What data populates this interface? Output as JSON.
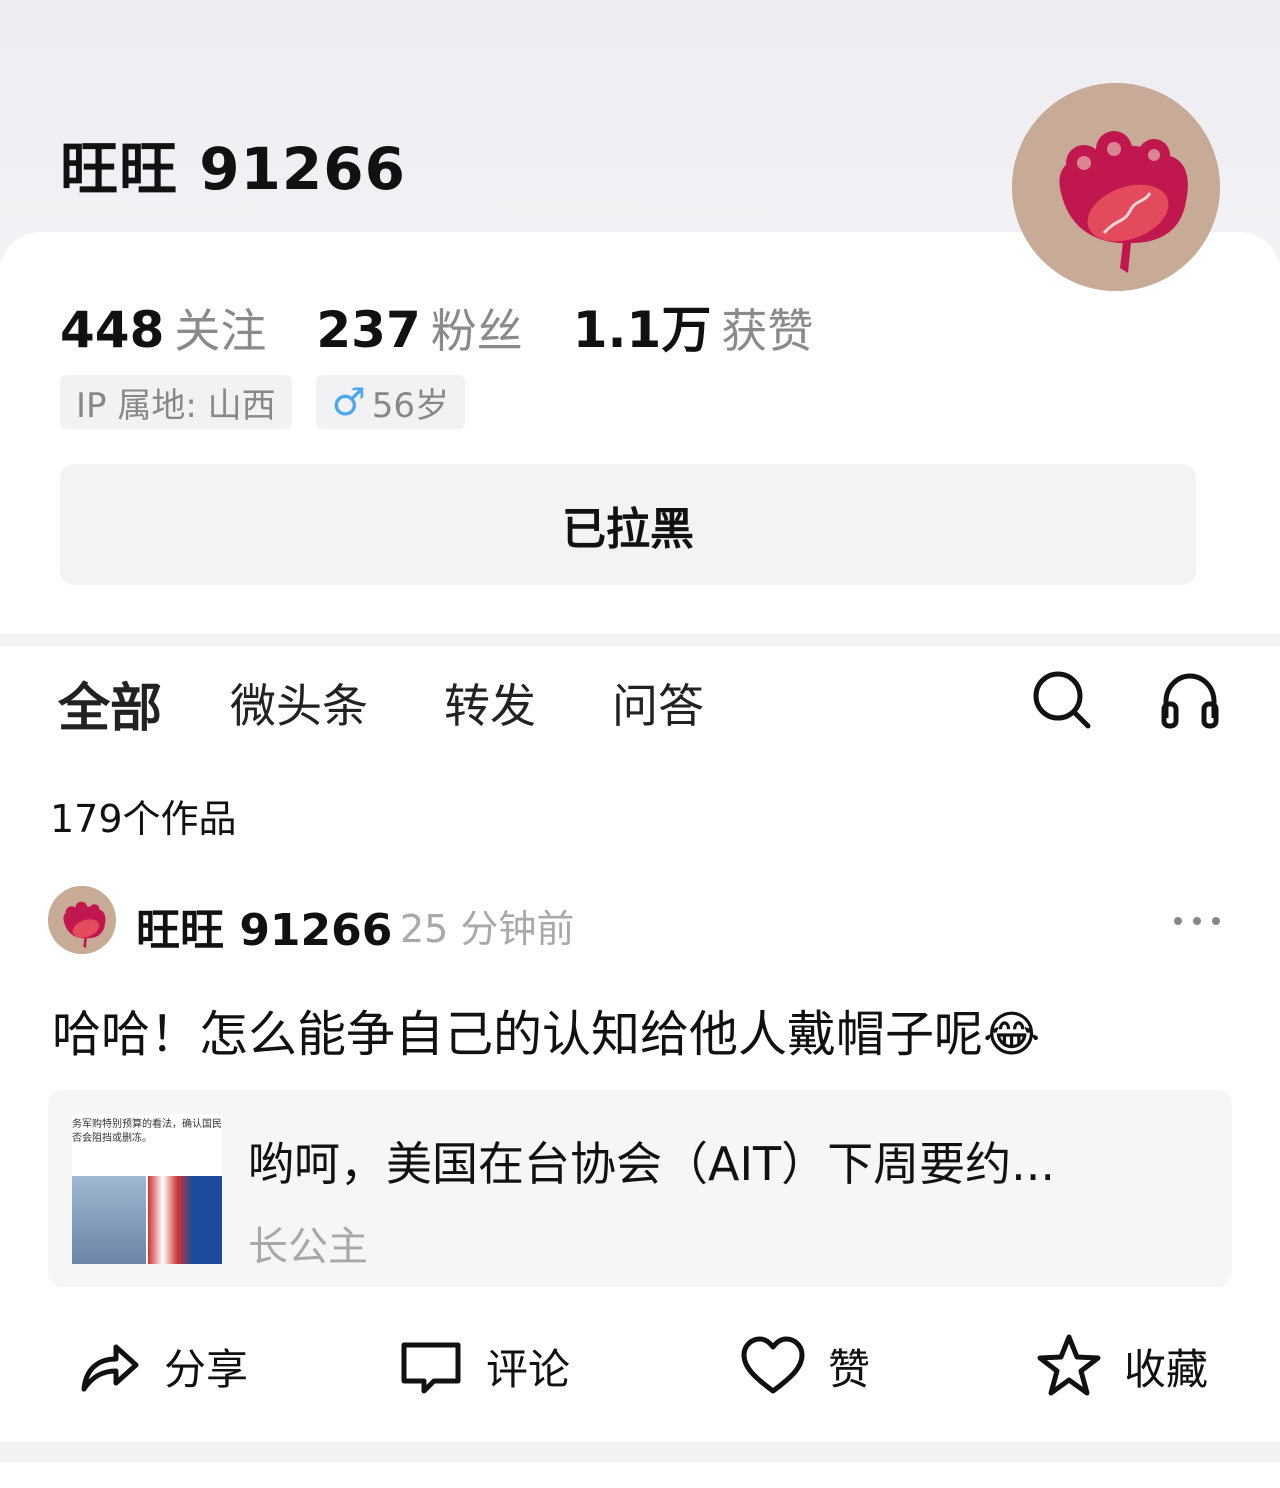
{
  "profile": {
    "username": "旺旺 91266",
    "stats": [
      {
        "num": "448",
        "label": "关注"
      },
      {
        "num": "237",
        "label": "粉丝"
      },
      {
        "num": "1.1万",
        "label": "获赞"
      }
    ],
    "ip_location": "IP 属地: 山西",
    "gender_symbol": "♂",
    "age": "56岁",
    "blocked_button": "已拉黑"
  },
  "tabs": [
    {
      "label": "全部",
      "active": true
    },
    {
      "label": "微头条",
      "active": false
    },
    {
      "label": "转发",
      "active": false
    },
    {
      "label": "问答",
      "active": false
    }
  ],
  "icons": {
    "search": "search-icon",
    "headphones": "headphones-icon",
    "more": "more-icon"
  },
  "works_count": "179个作品",
  "post": {
    "author": "旺旺 91266",
    "time": "25 分钟前",
    "text": "哈哈！怎么能争自己的认知给他人戴帽子呢😂",
    "quote": {
      "title": "哟呵，美国在台协会（AIT）下周要约...",
      "author": "长公主",
      "thumb_line1": "务军购特别预算的看法，确认国民党",
      "thumb_line2": "否会阻挡或删冻。"
    },
    "actions": [
      {
        "label": "分享",
        "icon": "share-icon"
      },
      {
        "label": "评论",
        "icon": "comment-icon"
      },
      {
        "label": "赞",
        "icon": "heart-icon"
      },
      {
        "label": "收藏",
        "icon": "star-icon"
      }
    ]
  },
  "colors": {
    "avatar_bg": "#c8ab96",
    "avatar_flower": "#c1174f",
    "male_icon": "#4aa8f0",
    "muted_text": "#8a8a8a"
  }
}
